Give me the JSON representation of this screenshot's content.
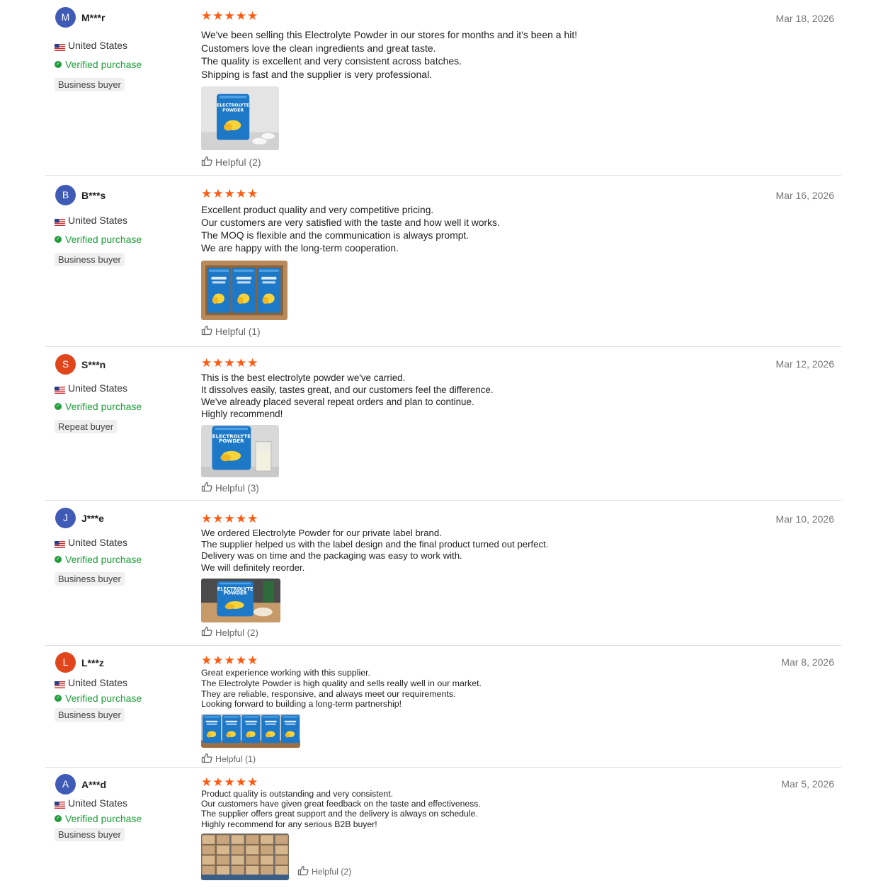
{
  "reviews": [
    {
      "initial": "M",
      "name": "M***r",
      "avatar_color": "#3f5bb6",
      "country": "United States",
      "verified": "Verified purchase",
      "badge": "Business buyer",
      "rating": 5,
      "date": "Mar 18, 2026",
      "text": [
        "We've been selling this Electrolyte Powder in our stores for months and it's been a hit!",
        "Customers love the clean ingredients and great taste.",
        "The quality is excellent and very consistent across batches.",
        "Shipping is fast and the supplier is very professional."
      ],
      "photo": "single-pouch-with-tablets",
      "photo_label": [
        "ELECTROLYTE",
        "POWDER"
      ],
      "helpful": "Helpful (2)"
    },
    {
      "initial": "B",
      "name": "B***s",
      "avatar_color": "#3f5bb6",
      "country": "United States",
      "verified": "Verified purchase",
      "badge": "Business buyer",
      "rating": 5,
      "date": "Mar 16, 2026",
      "text": [
        "Excellent product quality and very competitive pricing.",
        "Our customers are very satisfied with the taste and how well it works.",
        "The MOQ is flexible and the communication is always prompt.",
        "We are happy with the long-term cooperation."
      ],
      "photo": "pouches-in-box",
      "helpful": "Helpful (1)"
    },
    {
      "initial": "S",
      "name": "S***n",
      "avatar_color": "#e0451b",
      "country": "United States",
      "verified": "Verified purchase",
      "badge": "Repeat buyer",
      "rating": 5,
      "date": "Mar 12, 2026",
      "text": [
        "This is the best electrolyte powder we've carried.",
        "It dissolves easily, tastes great, and our customers feel the difference.",
        "We've already placed several repeat orders and plan to continue.",
        "Highly recommend!"
      ],
      "photo": "pouch-with-glass",
      "photo_label": [
        "ELECTROLYTE",
        "POWDER"
      ],
      "helpful": "Helpful (3)"
    },
    {
      "initial": "J",
      "name": "J***e",
      "avatar_color": "#3f5bb6",
      "country": "United States",
      "verified": "Verified purchase",
      "badge": "Business buyer",
      "rating": 5,
      "date": "Mar 10, 2026",
      "text": [
        "We ordered Electrolyte Powder for our private label brand.",
        "The supplier helped us with the label design and the final product turned out perfect.",
        "Delivery was on time and the packaging was easy to work with.",
        "We will definitely reorder."
      ],
      "photo": "pouch-on-table",
      "photo_label": [
        "ELECTROLYTE",
        "POWDER"
      ],
      "helpful": "Helpful (2)"
    },
    {
      "initial": "L",
      "name": "L***z",
      "avatar_color": "#e0451b",
      "country": "United States",
      "verified": "Verified purchase",
      "badge": "Business buyer",
      "rating": 5,
      "date": "Mar 8, 2026",
      "text": [
        "Great experience working with this supplier.",
        "The Electrolyte Powder is high quality and sells really well in our market.",
        "They are reliable, responsive, and always meet our requirements.",
        "Looking forward to building a long-term partnership!"
      ],
      "photo": "row-of-pouches",
      "helpful": "Helpful (1)"
    },
    {
      "initial": "A",
      "name": "A***d",
      "avatar_color": "#3f5bb6",
      "country": "United States",
      "verified": "Verified purchase",
      "badge": "Business buyer",
      "rating": 5,
      "date": "Mar 5, 2026",
      "text": [
        "Product quality is outstanding and very consistent.",
        "Our customers have given great feedback on the taste and effectiveness.",
        "The supplier offers great support and the delivery is always on schedule.",
        "Highly recommend for any serious B2B buyer!"
      ],
      "photo": "pallets-of-cartons",
      "helpful": "Helpful (2)"
    }
  ]
}
